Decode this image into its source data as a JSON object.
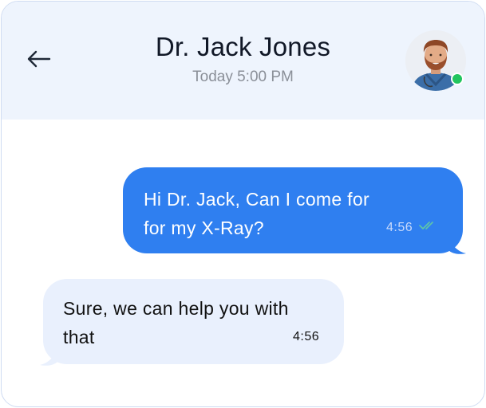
{
  "header": {
    "title": "Dr. Jack Jones",
    "subtitle": "Today 5:00 PM",
    "back_icon": "arrow-left-icon",
    "avatar_icon": "doctor-avatar",
    "status_color": "#22c55e"
  },
  "messages": [
    {
      "direction": "outgoing",
      "text": "Hi Dr. Jack, Can I come for for my X-Ray?",
      "time": "4:56",
      "read_icon": "double-check-icon",
      "bubble_color": "#2f7ff0"
    },
    {
      "direction": "incoming",
      "text": "Sure, we can help you with that",
      "time": "4:56",
      "bubble_color": "#e9f0fd"
    }
  ]
}
